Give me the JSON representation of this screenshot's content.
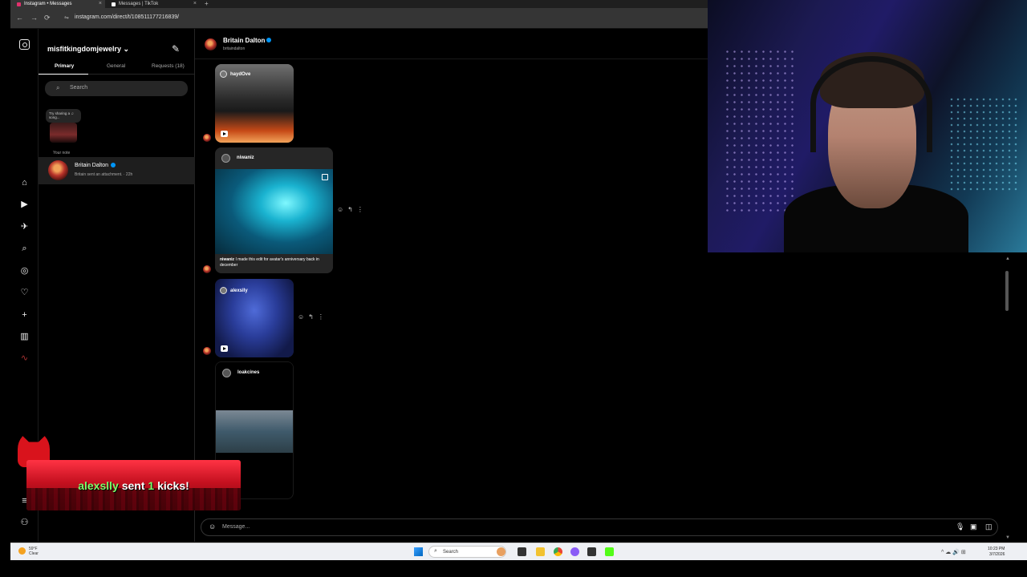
{
  "browser": {
    "tabs": [
      {
        "title": "Instagram • Messages",
        "active": true,
        "favicon_color": "#e1306c"
      },
      {
        "title": "Messages | TikTok",
        "active": false,
        "favicon_color": "#ffffff"
      }
    ],
    "close_glyph": "×",
    "new_tab_glyph": "+",
    "url": "instagram.com/direct/t/108511177216839/",
    "nav": {
      "back": "←",
      "forward": "→",
      "reload": "⟳",
      "site_info": "⇋"
    }
  },
  "rail": {
    "icons": [
      "instagram-logo-icon",
      "home-icon",
      "reels-icon",
      "messages-icon",
      "search-icon",
      "explore-icon",
      "notifications-icon",
      "create-icon",
      "dashboard-icon",
      "threads-icon",
      "menu-icon",
      "meta-icon"
    ],
    "glyphs": {
      "home": "⌂",
      "reels": "▶",
      "messages": "✈",
      "search": "⌕",
      "explore": "◎",
      "notifications": "♡",
      "create": "+",
      "dashboard": "▥",
      "threads": "∿",
      "menu": "≡",
      "meta": "⚇"
    }
  },
  "dm_panel": {
    "account": "misfitkingdomjewelry",
    "account_chevron": "⌄",
    "compose_glyph": "✎",
    "tabs": {
      "primary": "Primary",
      "general": "General",
      "requests": "Requests (18)"
    },
    "search_icon": "⌕",
    "search_placeholder": "Search",
    "note_text": "Try sharing a ♫ song...",
    "your_note": "Your note",
    "conversations": [
      {
        "name": "Britain Dalton",
        "verified": true,
        "preview": "Britain sent an attachment. · 22h"
      }
    ]
  },
  "chat": {
    "header": {
      "name": "Britain Dalton",
      "handle": "britaindalton",
      "verified": true
    },
    "messages": [
      {
        "type": "reel",
        "user": "haydOve"
      },
      {
        "type": "post",
        "user": "niwaniz",
        "caption_user": "niwaniz",
        "caption": "I made this edit for avatar's anniversary back in december"
      },
      {
        "type": "reel",
        "user": "alexslly"
      },
      {
        "type": "post",
        "user": "loakcines"
      }
    ],
    "hover_actions": {
      "react": "☺",
      "reply": "↰",
      "more": "⋮"
    },
    "composer": {
      "emoji": "☺",
      "placeholder": "Message...",
      "mic": "🎙",
      "image": "▣",
      "sticker": "◫"
    }
  },
  "overlay": {
    "kick_alert": {
      "user": "alexslly",
      "verb": "sent",
      "count": "1",
      "noun": "kicks!"
    }
  },
  "taskbar": {
    "weather_temp": "59°F",
    "weather_desc": "Clear",
    "search_icon": "⌕",
    "search_label": "Search",
    "tray": "^ ☁ 🔊 ⊞",
    "time": "10:23 PM",
    "date": "3/7/2026"
  },
  "colors": {
    "verified": "#0095f6",
    "kick_green": "#7dff6b",
    "kick_red": "#c4101f"
  }
}
